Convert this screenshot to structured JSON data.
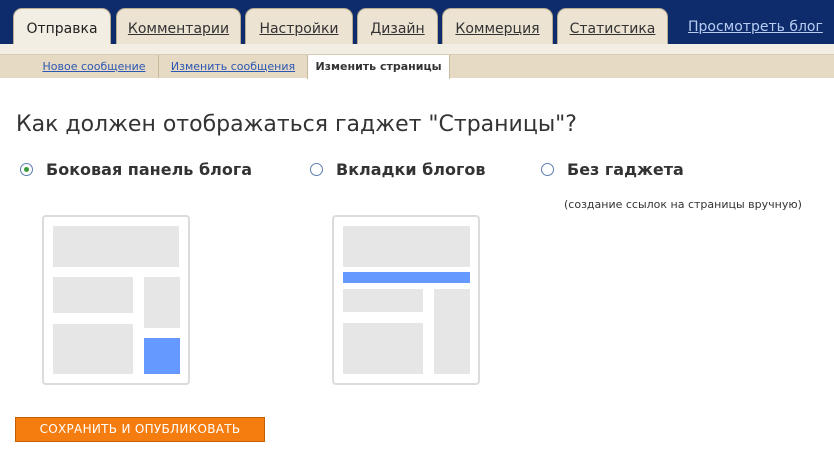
{
  "tabs": [
    {
      "label": "Отправка",
      "active": true
    },
    {
      "label": "Комментарии",
      "active": false
    },
    {
      "label": "Настройки",
      "active": false
    },
    {
      "label": "Дизайн",
      "active": false
    },
    {
      "label": "Коммерция",
      "active": false
    },
    {
      "label": "Статистика",
      "active": false
    }
  ],
  "view_blog_label": "Просмотреть блог",
  "subtabs": [
    {
      "label": "Новое сообщение",
      "active": false
    },
    {
      "label": "Изменить сообщения",
      "active": false
    },
    {
      "label": "Изменить страницы",
      "active": true
    }
  ],
  "page_title": "Как должен отображаться гаджет \"Страницы\"?",
  "options": [
    {
      "label": "Боковая панель блога",
      "checked": true
    },
    {
      "label": "Вкладки блогов",
      "checked": false
    },
    {
      "label": "Без гаджета",
      "checked": false
    }
  ],
  "no_gadget_note": "(создание ссылок на страницы вручную)",
  "save_button_label": "СОХРАНИТЬ И ОПУБЛИКОВАТЬ",
  "colors": {
    "header_bg": "#0e2c6c",
    "tab_bg": "#ece3d3",
    "preview_block": "#e6e6e6",
    "preview_accent": "#6699ff",
    "radio_checked": "#3c9a3c",
    "save_button": "#f57c0f"
  }
}
